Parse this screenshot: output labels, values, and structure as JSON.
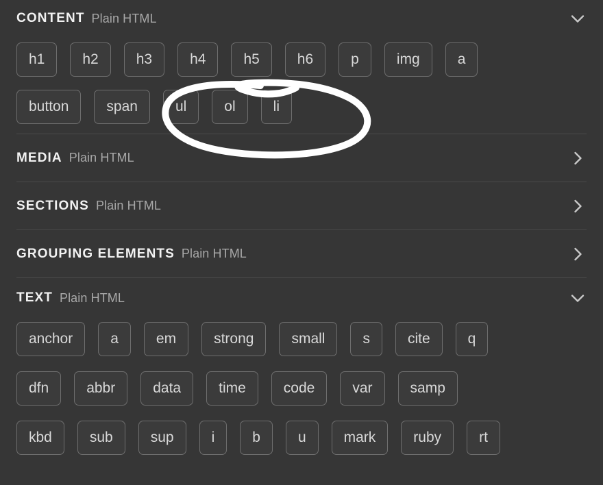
{
  "colors": {
    "background": "#363636",
    "pill_fill": "#3b3b3b",
    "pill_border": "#6e6e6e",
    "pill_text": "#d8d8d8",
    "title_text": "#f2f2f2",
    "subtitle_text": "#a8a8a8",
    "divider": "#4a4a4a",
    "annotation": "#ffffff"
  },
  "sections": [
    {
      "title": "CONTENT",
      "subtitle": "Plain HTML",
      "state": "expanded",
      "chevron": "chevron-down-icon",
      "rows": [
        [
          "h1",
          "h2",
          "h3",
          "h4",
          "h5",
          "h6",
          "p",
          "img",
          "a"
        ],
        [
          "button",
          "span",
          "ul",
          "ol",
          "li"
        ]
      ]
    },
    {
      "title": "MEDIA",
      "subtitle": "Plain HTML",
      "state": "collapsed",
      "chevron": "chevron-right-icon",
      "rows": []
    },
    {
      "title": "SECTIONS",
      "subtitle": "Plain HTML",
      "state": "collapsed",
      "chevron": "chevron-right-icon",
      "rows": []
    },
    {
      "title": "GROUPING ELEMENTS",
      "subtitle": "Plain HTML",
      "state": "collapsed",
      "chevron": "chevron-right-icon",
      "rows": []
    },
    {
      "title": "TEXT",
      "subtitle": "Plain HTML",
      "state": "expanded",
      "chevron": "chevron-down-icon",
      "rows": [
        [
          "anchor",
          "a",
          "em",
          "strong",
          "small",
          "s",
          "cite",
          "q"
        ],
        [
          "dfn",
          "abbr",
          "data",
          "time",
          "code",
          "var",
          "samp"
        ],
        [
          "kbd",
          "sub",
          "sup",
          "i",
          "b",
          "u",
          "mark",
          "ruby",
          "rt"
        ]
      ]
    }
  ],
  "annotation": {
    "type": "hand-drawn-ellipse",
    "encircles": [
      "ul",
      "ol",
      "li"
    ],
    "color": "#ffffff"
  }
}
